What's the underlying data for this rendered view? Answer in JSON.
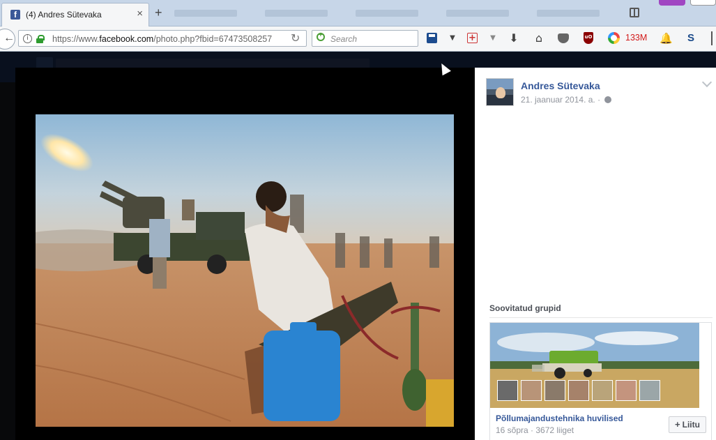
{
  "browser": {
    "tab": {
      "title": "(4) Andres Sütevaka",
      "favicon": "f"
    },
    "url": {
      "prefix": "https://www.",
      "domain": "facebook.com",
      "path": "/photo.php?fbid=67473508257"
    },
    "search_placeholder": "Search",
    "memory_label": "133M",
    "icons": [
      "info-icon",
      "lock-icon",
      "reload-icon",
      "search-icon",
      "save-icon",
      "addon-icon",
      "download-icon",
      "home-icon",
      "pocket-icon",
      "ublock-icon",
      "memory-icon",
      "notifications-icon",
      "s-icon"
    ]
  },
  "post": {
    "author": "Andres Sütevaka",
    "date": "21. jaanuar 2014. a. ·"
  },
  "suggested_groups": {
    "title": "Soovitatud grupid",
    "group": {
      "name": "Põllumajandustehnika huvilised",
      "meta": "16 sõpra · 3672 liiget",
      "join_label": "Liitu"
    }
  },
  "colors": {
    "fb_blue": "#365899",
    "muted": "#90949c",
    "viewer_bg": "#000000"
  }
}
